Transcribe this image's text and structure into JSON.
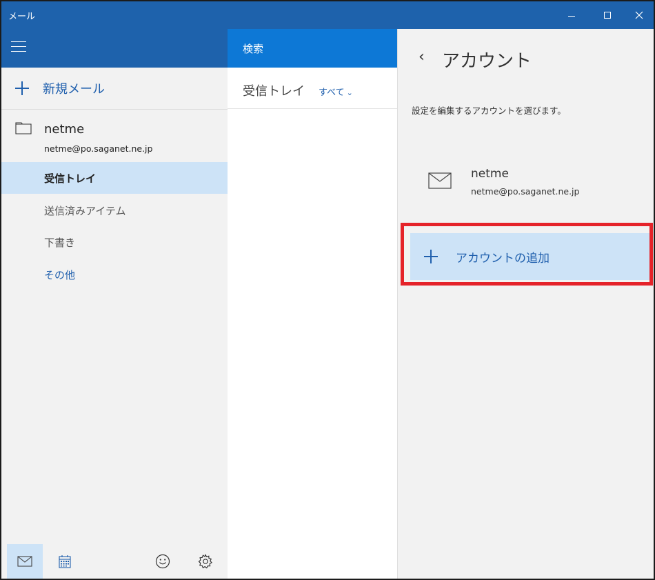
{
  "window": {
    "title": "メール",
    "controls": {
      "minimize": "minimize-icon",
      "maximize": "maximize-icon",
      "close": "close-icon"
    }
  },
  "leftpane": {
    "new_mail_label": "新規メール",
    "account": {
      "name": "netme",
      "email": "netme@po.saganet.ne.jp"
    },
    "folders": [
      {
        "label": "受信トレイ",
        "selected": true
      },
      {
        "label": "送信済みアイテム",
        "selected": false
      },
      {
        "label": "下書き",
        "selected": false
      },
      {
        "label": "その他",
        "selected": false
      }
    ]
  },
  "midpane": {
    "search_label": "検索",
    "inbox_title": "受信トレイ",
    "filter_label": "すべて"
  },
  "rightpane": {
    "title": "アカウント",
    "description": "設定を編集するアカウントを選びます。",
    "account": {
      "name": "netme",
      "email": "netme@po.saganet.ne.jp"
    },
    "add_account_label": "アカウントの追加"
  },
  "colors": {
    "titlebar": "#1e62ac",
    "search_bar": "#0d78d6",
    "selection": "#cde3f7",
    "accent_text": "#1f5fad",
    "highlight_border": "#e5232a"
  }
}
